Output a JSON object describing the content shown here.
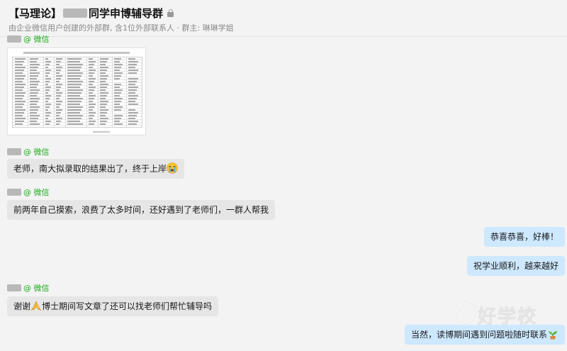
{
  "header": {
    "title_prefix": "【马理论】",
    "title_suffix": "同学申博辅导群",
    "subtitle": "由企业微信用户创建的外部群, 含1位外部联系人 · 群主: 琳琳学姐"
  },
  "messages": [
    {
      "side": "left",
      "sender_suffix": "@ 微信",
      "kind": "image"
    },
    {
      "side": "left",
      "sender_suffix": "@ 微信",
      "text": "老师，南大拟录取的结果出了，终于上岸",
      "emoji": "crying-face-icon"
    },
    {
      "side": "left",
      "sender_suffix": "@ 微信",
      "text": "前两年自己摸索，浪费了太多时间，还好遇到了老师们，一群人帮我"
    },
    {
      "side": "right",
      "text": "恭喜恭喜，好棒！"
    },
    {
      "side": "right",
      "text": "祝学业顺利，越来越好"
    },
    {
      "side": "left",
      "sender_suffix": "@ 微信",
      "text_before": "谢谢",
      "emoji": "folded-hands-icon",
      "text_after": "博士期间写文章了还可以找老师们帮忙辅导吗"
    },
    {
      "side": "right",
      "text": "当然，读博期间遇到问题啦随时联系",
      "emoji": "plant-sprout-icon"
    }
  ],
  "watermark": {
    "text": "好学校"
  },
  "colors": {
    "accent_wechat": "#1aad19",
    "bubble_self": "#cde8ff",
    "bubble_other": "#e6e6e6",
    "background": "#f3f3f3"
  }
}
